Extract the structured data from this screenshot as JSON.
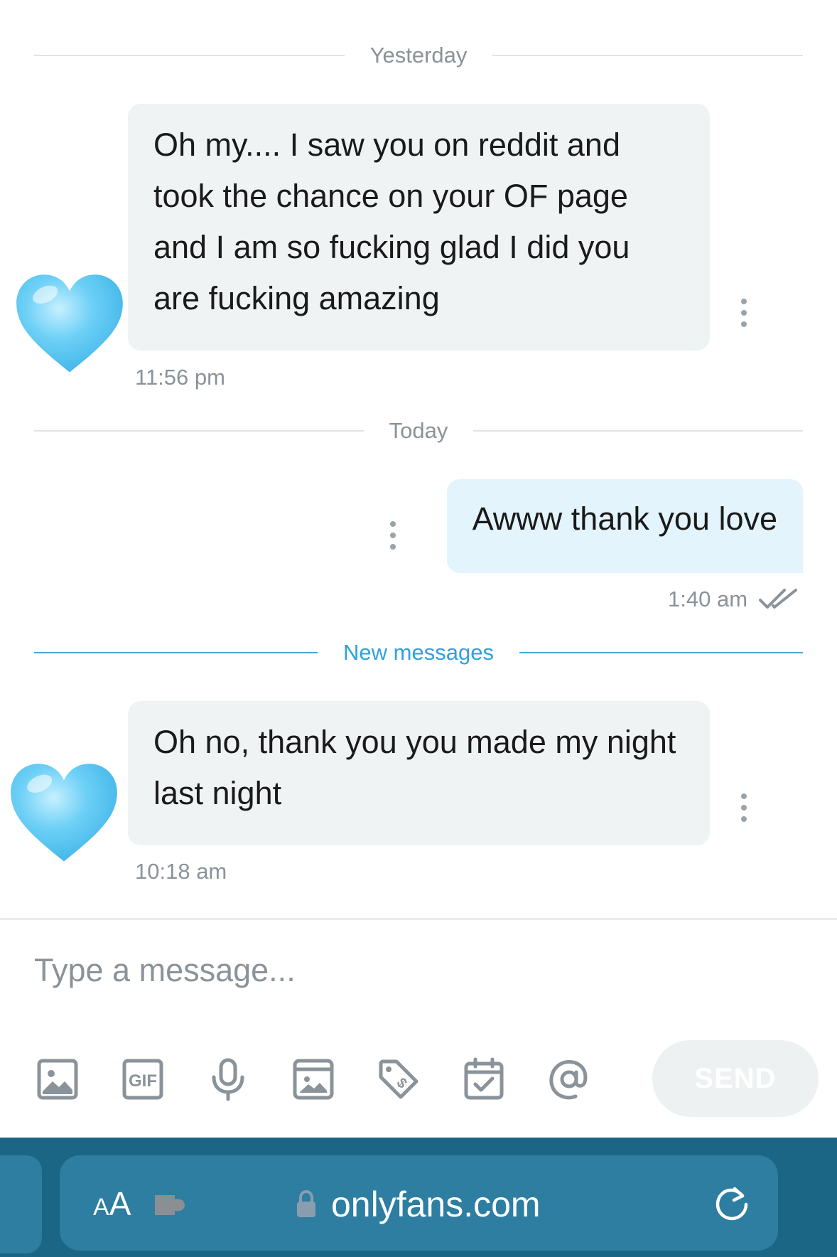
{
  "dividers": {
    "yesterday": "Yesterday",
    "today": "Today",
    "new_messages": "New messages"
  },
  "messages": [
    {
      "direction": "incoming",
      "text": "Oh my.... I saw you on reddit and took the chance on your OF page and I am so fucking glad I did you are fucking amazing",
      "time": "11:56 pm",
      "avatar_icon": "blue-heart-icon"
    },
    {
      "direction": "outgoing",
      "text": "Awww thank you love",
      "time": "1:40 am",
      "status_icon": "double-check-icon"
    },
    {
      "direction": "incoming",
      "text": "Oh no, thank you you made my night last night",
      "time": "10:18 am",
      "avatar_icon": "blue-heart-icon"
    }
  ],
  "composer": {
    "placeholder": "Type a message...",
    "toolbar_icons": [
      "image-icon",
      "gif-icon",
      "microphone-icon",
      "media-vault-icon",
      "price-tag-icon",
      "calendar-icon",
      "at-sign-icon"
    ],
    "send_label": "SEND"
  },
  "browser": {
    "text_size_label": "AA",
    "url": "onlyfans.com",
    "icons": [
      "extension-icon",
      "lock-icon",
      "reload-icon"
    ]
  },
  "colors": {
    "incoming_bubble": "#f0f3f4",
    "outgoing_bubble": "#e3f4fc",
    "accent": "#2ea2dc",
    "browser_bar": "#1b6585",
    "url_pill": "#2d7ea1"
  }
}
